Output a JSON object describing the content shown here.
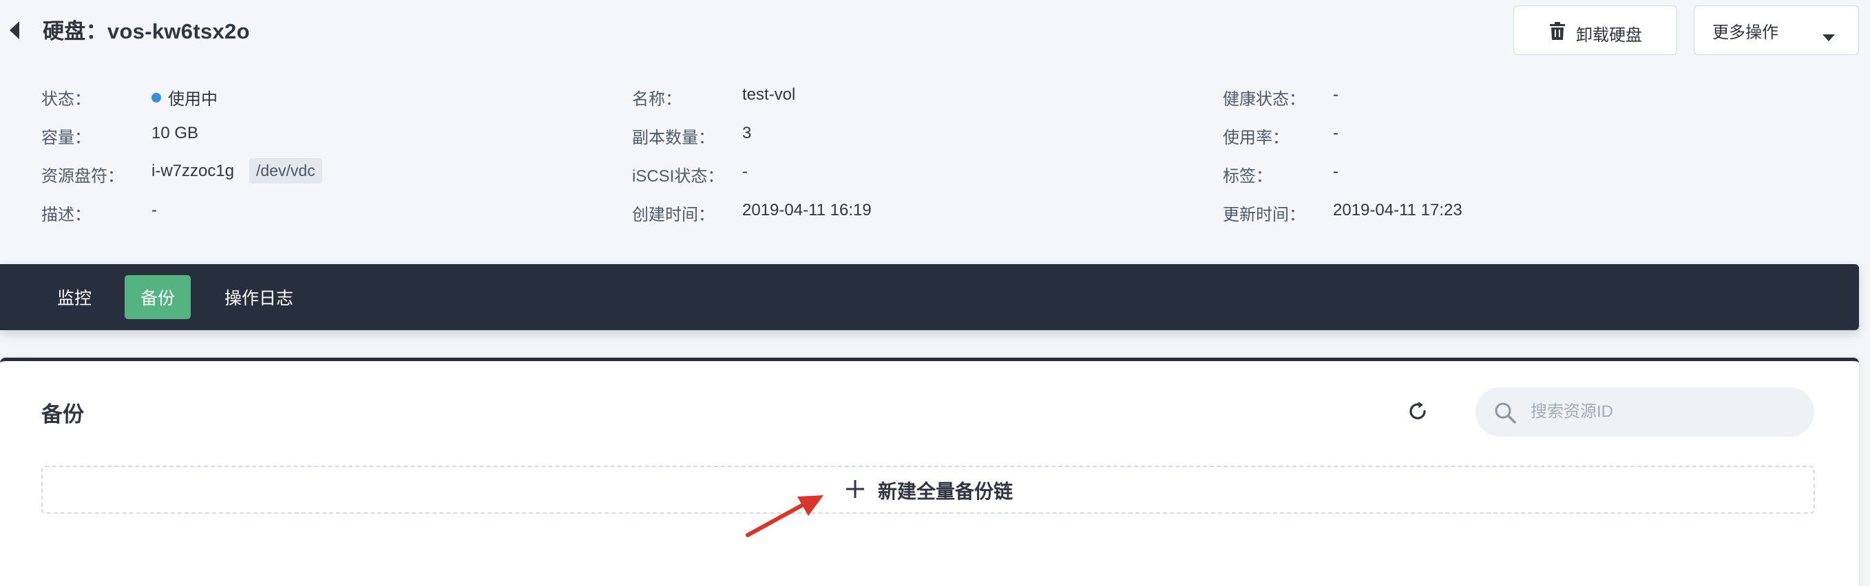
{
  "header": {
    "title": "硬盘：vos-kw6tsx2o",
    "unmount_label": "卸载硬盘",
    "more_label": "更多操作"
  },
  "info": {
    "col1": [
      {
        "label": "状态：",
        "value": "使用中"
      },
      {
        "label": "容量：",
        "value": "10 GB"
      },
      {
        "label": "资源盘符：",
        "value": "i-w7zzoc1g",
        "tag": "/dev/vdc"
      },
      {
        "label": "描述：",
        "value": "-"
      }
    ],
    "col2": [
      {
        "label": "名称：",
        "value": "test-vol"
      },
      {
        "label": "副本数量：",
        "value": "3"
      },
      {
        "label": "iSCSI状态：",
        "value": "-"
      },
      {
        "label": "创建时间：",
        "value": "2019-04-11 16:19"
      }
    ],
    "col3": [
      {
        "label": "健康状态：",
        "value": "-"
      },
      {
        "label": "使用率：",
        "value": "-"
      },
      {
        "label": "标签：",
        "value": "-"
      },
      {
        "label": "更新时间：",
        "value": "2019-04-11 17:23"
      }
    ]
  },
  "tabs": [
    {
      "label": "监控",
      "active": false
    },
    {
      "label": "备份",
      "active": true
    },
    {
      "label": "操作日志",
      "active": false
    }
  ],
  "backup": {
    "title": "备份",
    "search_placeholder": "搜索资源ID",
    "create_label": "新建全量备份链"
  },
  "colors": {
    "tabbar_bg": "#272e3d",
    "tab_active": "#55b281",
    "status_dot": "#3b8ed8",
    "annotation_arrow": "#d9352a"
  },
  "icons": {
    "back": "caret-left-icon",
    "unmount": "trash-icon",
    "more": "caret-down-icon",
    "refresh": "refresh-icon",
    "search": "search-icon",
    "create": "plus-icon"
  }
}
